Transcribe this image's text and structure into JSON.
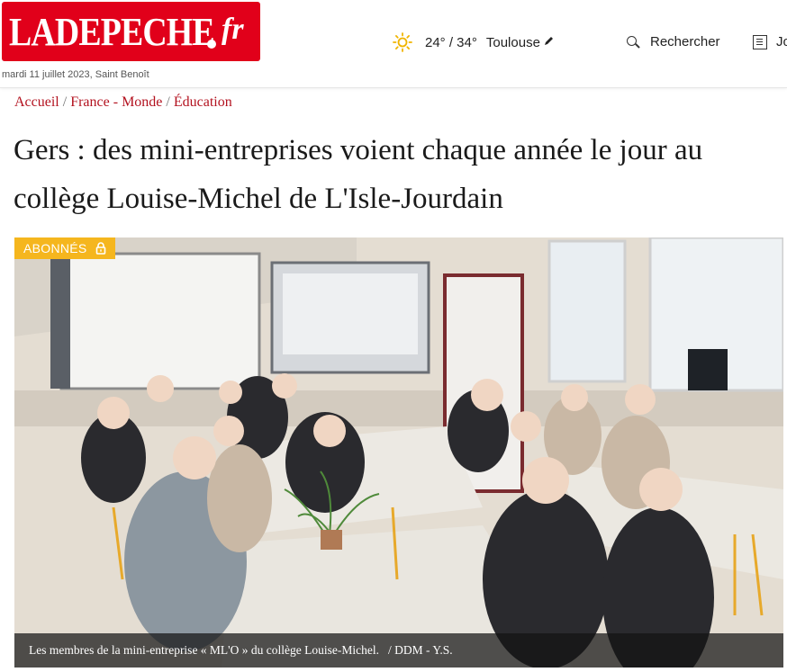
{
  "header": {
    "logo_text": "LADEPECHE",
    "logo_suffix": "fr",
    "dateline": "mardi 11 juillet 2023, Saint Benoît",
    "weather": {
      "icon": "sun-icon",
      "temps": "24° / 34°",
      "city": "Toulouse"
    },
    "search_label": "Rechercher",
    "journal_label": "Jo"
  },
  "breadcrumb": [
    "Accueil",
    "France - Monde",
    "Éducation"
  ],
  "article": {
    "title": "Gers : des mini-entreprises voient chaque année le jour au collège Louise-Michel de L'Isle-Jourdain",
    "badge": "ABONNÉS",
    "photo": {
      "caption": "Les membres de la mini-entreprise « ML'O » du collège Louise-Michel.",
      "credit": "/ DDM - Y.S."
    }
  },
  "colors": {
    "brand_red": "#e1001a",
    "link_red": "#b3121f",
    "badge_yellow": "#f5b61e"
  }
}
